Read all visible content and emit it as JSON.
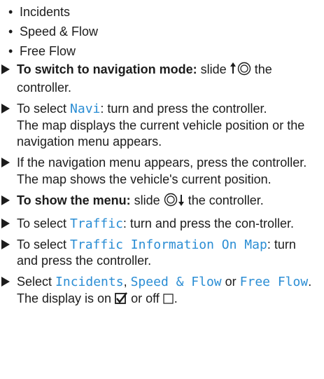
{
  "bullets": [
    "Incidents",
    "Speed & Flow",
    "Free Flow"
  ],
  "steps": {
    "s1": {
      "bold": "To switch to navigation mode:",
      "text_before_icon": " slide ",
      "text_after_icon": " the controller."
    },
    "s2": {
      "text_before": "To select ",
      "ui": "Navi",
      "text_after": ": turn and press the controller.",
      "result": "The map displays the current vehicle position or the navigation menu appears."
    },
    "s3": {
      "text": "If the navigation menu appears, press the controller.",
      "result": "The map shows the vehicle's current position."
    },
    "s4": {
      "bold": "To show the menu:",
      "text_before_icon": " slide ",
      "text_after_icon": " the controller."
    },
    "s5": {
      "text_before": "To select ",
      "ui": "Traffic",
      "text_after": ": turn and press the con-troller."
    },
    "s6": {
      "text_before": "To select ",
      "ui": "Traffic Information On Map",
      "text_after": ": turn and press the controller."
    },
    "s7": {
      "text_before": "Select ",
      "ui1": "Incidents",
      "sep1": ", ",
      "ui2": "Speed & Flow",
      "sep2": " or ",
      "ui3": "Free Flow",
      "end": ".",
      "result_before": "The display is on ",
      "result_mid": " or off ",
      "result_end": "."
    }
  },
  "icons": {
    "slide_up": "controller-slide-up-icon",
    "slide_down": "controller-slide-down-icon",
    "checked": "checkbox-checked-icon",
    "unchecked": "checkbox-unchecked-icon"
  },
  "colors": {
    "text": "#1c1c1c",
    "ui_label": "#2a8dd4"
  }
}
